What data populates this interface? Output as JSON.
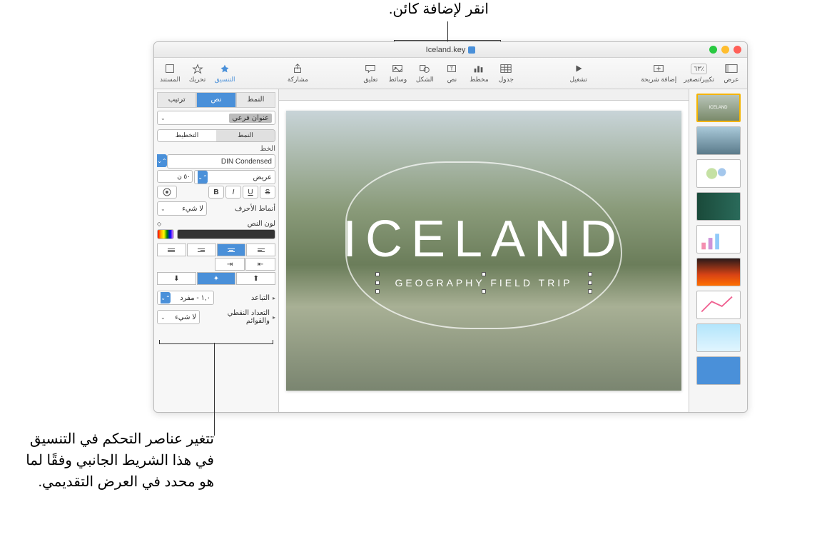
{
  "callouts": {
    "top": "انقر لإضافة كائن.",
    "bottom": "تتغير عناصر التحكم في التنسيق في هذا الشريط الجانبي وفقًا لما هو محدد في العرض التقديمي."
  },
  "window": {
    "title": "Iceland.key"
  },
  "toolbar": {
    "view": "عرض",
    "zoom_label": "تكبير/تصغير",
    "zoom_value": "٪٦٣",
    "add_slide": "إضافة شريحة",
    "play": "تشغيل",
    "table": "جدول",
    "chart": "مخطط",
    "text": "نص",
    "shape": "الشكل",
    "media": "وسائط",
    "comment": "تعليق",
    "share": "مشاركة",
    "format": "التنسيق",
    "animate": "تحريك",
    "document": "المستند"
  },
  "slide": {
    "title": "ICELAND",
    "subtitle": "GEOGRAPHY FIELD TRIP"
  },
  "thumbs": {
    "t1": "ICELAND"
  },
  "inspector": {
    "tabs": {
      "style": "النمط",
      "text": "نص",
      "arrange": "ترتيب"
    },
    "object_style": "عنوان فرعي",
    "seg": {
      "style": "النمط",
      "layout": "التخطيط"
    },
    "font_section": "الخط",
    "font_name": "DIN Condensed",
    "font_weight": "عريض",
    "font_size": "٥٠ ن",
    "char_styles_label": "أنماط الأحرف",
    "char_styles_value": "لا شيء",
    "text_color": "لون النص",
    "spacing_label": "التباعد",
    "spacing_value": "١,٠ - مفرد",
    "bullets_label": "التعداد النقطي والقوائم",
    "bullets_value": "لا شيء",
    "b": "B",
    "i": "I",
    "u": "U",
    "s": "S"
  }
}
